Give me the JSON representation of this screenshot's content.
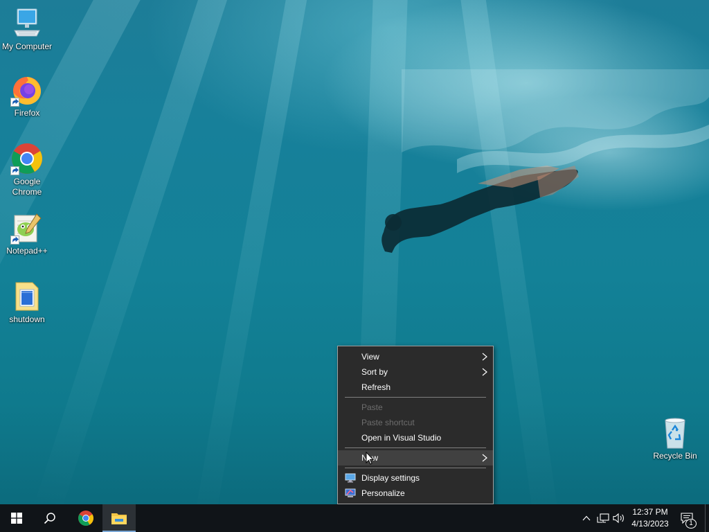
{
  "desktop": {
    "icons": [
      {
        "label": "My Computer",
        "icon": "computer-icon"
      },
      {
        "label": "Firefox",
        "icon": "firefox-icon"
      },
      {
        "label": "Google Chrome",
        "icon": "chrome-icon"
      },
      {
        "label": "Notepad++",
        "icon": "notepad-plus-plus-icon"
      },
      {
        "label": "shutdown",
        "icon": "batch-file-icon"
      },
      {
        "label": "Recycle Bin",
        "icon": "recycle-bin-icon"
      }
    ]
  },
  "context_menu": {
    "view": "View",
    "sort_by": "Sort by",
    "refresh": "Refresh",
    "paste": "Paste",
    "paste_shortcut": "Paste shortcut",
    "open_vs": "Open in Visual Studio",
    "new": "New",
    "display_settings": "Display settings",
    "personalize": "Personalize"
  },
  "taskbar": {
    "clock_time": "12:37 PM",
    "clock_date": "4/13/2023",
    "notification_count": "1",
    "pinned": [
      "windows-start-icon",
      "search-icon",
      "chrome-icon",
      "file-explorer-icon"
    ]
  },
  "colors": {
    "menu_bg": "#2b2b2b",
    "menu_hover": "#414141",
    "menu_disabled_text": "#6d6d6d",
    "taskbar_bg": "#101418"
  }
}
